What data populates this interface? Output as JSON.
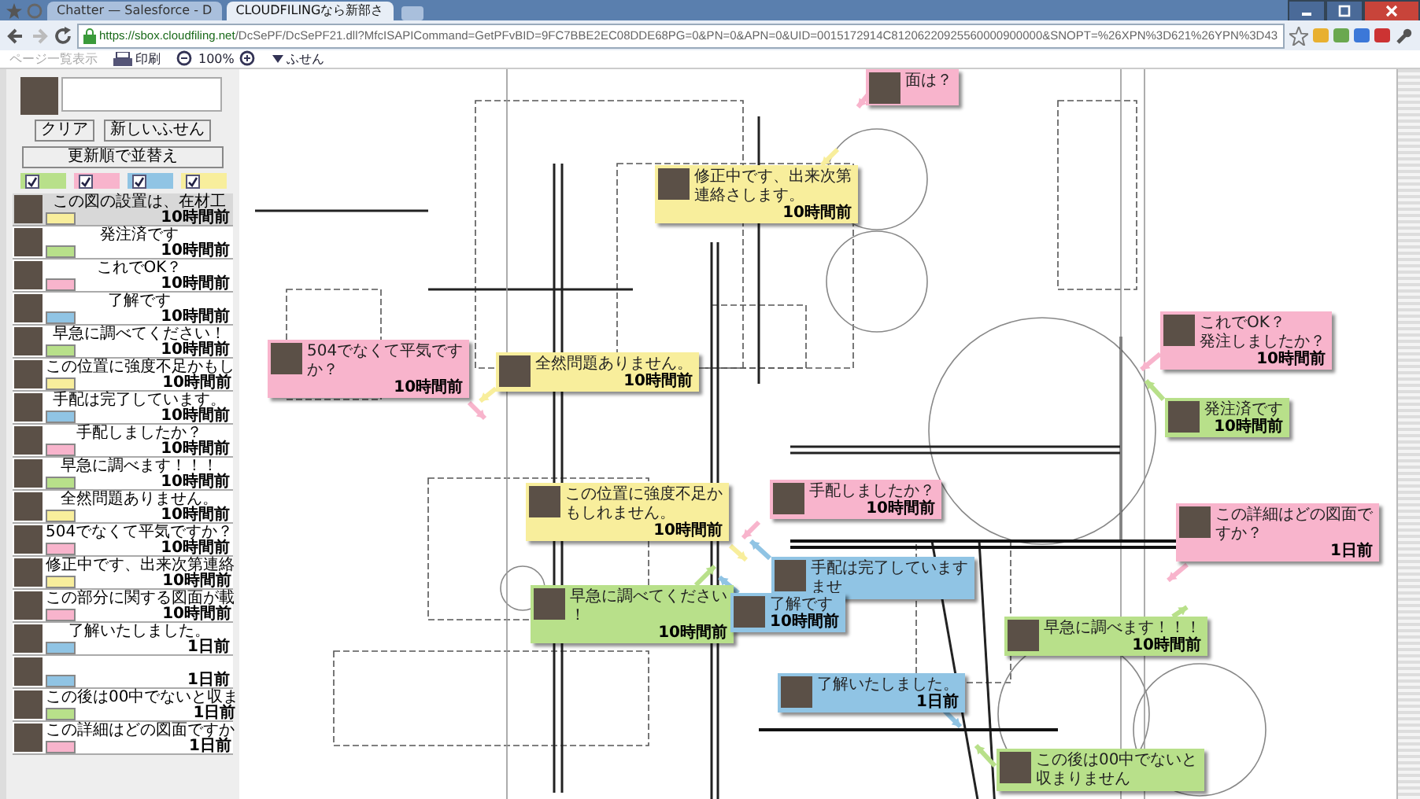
{
  "browser": {
    "tabs": [
      {
        "title": "Chatter — Salesforce - D",
        "selected": false
      },
      {
        "title": "CLOUDFILINGなら新部さ",
        "selected": true
      }
    ],
    "url_host": "https://sbox.cloudfiling.net",
    "url_path": "/DcSePF/DcSePF21.dll?MfcISAPICommand=GetPFvBID=9FC7BBE2EC08DDE68PG=0&PN=0&APN=0&UID=0015172914C81206220925560000900000&SNOPT=%26XPN%3D621%26YPN%3D43"
  },
  "toolbar": {
    "items": [
      {
        "label": "ページ一覧表示",
        "disabled": true
      },
      {
        "label": "印刷",
        "disabled": false
      }
    ],
    "zoom": "100%",
    "sticky_menu": "ふせん"
  },
  "sidebar": {
    "buttons": [
      "クリア",
      "新しいふせん"
    ],
    "sort_button": "更新順で並替え",
    "filters": [
      {
        "color": "#b8e08a",
        "checked": true
      },
      {
        "color": "#f8b4cc",
        "checked": true
      },
      {
        "color": "#90c4e4",
        "checked": true
      },
      {
        "color": "#f8ee9c",
        "checked": true
      }
    ],
    "items": [
      {
        "text": "この図の設置は、在材工",
        "time": "10時間前",
        "color": "#f8ee9c",
        "selected": true
      },
      {
        "text": "発注済です",
        "time": "10時間前",
        "color": "#b8e08a",
        "selected": false
      },
      {
        "text": "これでOK？",
        "time": "10時間前",
        "color": "#f8b4cc",
        "selected": false
      },
      {
        "text": "了解です",
        "time": "10時間前",
        "color": "#90c4e4",
        "selected": false
      },
      {
        "text": "早急に調べてください！",
        "time": "10時間前",
        "color": "#b8e08a",
        "selected": false
      },
      {
        "text": "この位置に強度不足かもし",
        "time": "10時間前",
        "color": "#f8ee9c",
        "selected": false
      },
      {
        "text": "手配は完了しています。",
        "time": "10時間前",
        "color": "#90c4e4",
        "selected": false
      },
      {
        "text": "手配しましたか？",
        "time": "10時間前",
        "color": "#f8b4cc",
        "selected": false
      },
      {
        "text": "早急に調べます！！！",
        "time": "10時間前",
        "color": "#b8e08a",
        "selected": false
      },
      {
        "text": "全然問題ありません。",
        "time": "10時間前",
        "color": "#f8ee9c",
        "selected": false
      },
      {
        "text": "504でなくて平気ですか？",
        "time": "10時間前",
        "color": "#f8b4cc",
        "selected": false
      },
      {
        "text": "修正中です、出来次第連絡",
        "time": "10時間前",
        "color": "#f8ee9c",
        "selected": false
      },
      {
        "text": "この部分に関する図面が載",
        "time": "10時間前",
        "color": "#f8b4cc",
        "selected": false
      },
      {
        "text": "了解いたしました。",
        "time": "1日前",
        "color": "#90c4e4",
        "selected": false
      },
      {
        "time": "1日前",
        "color": "#90c4e4",
        "selected": false
      },
      {
        "text": "この後は00中でないと収ま",
        "time": "1日前",
        "color": "#b8e08a",
        "selected": false
      },
      {
        "text": "この詳細はどの図面ですか",
        "time": "1日前",
        "color": "#f8b4cc",
        "selected": false
      }
    ]
  },
  "notes": [
    {
      "lines": [
        "面は？"
      ],
      "color": "#f8b4cc"
    },
    {
      "lines": [
        "修正中です、出来次第",
        "連絡さします。"
      ],
      "time": "10時間前",
      "color": "#f8ee9c"
    },
    {
      "lines": [
        "504でなくて平気です",
        "か？"
      ],
      "time": "10時間前",
      "color": "#f8b4cc"
    },
    {
      "lines": [
        "全然問題ありません。"
      ],
      "time": "10時間前",
      "color": "#f8ee9c"
    },
    {
      "lines": [
        "これでOK？",
        "発注しましたか？"
      ],
      "time": "10時間前",
      "color": "#f8b4cc"
    },
    {
      "lines": [
        "発注済です"
      ],
      "time": "10時間前",
      "color": "#b8e08a"
    },
    {
      "lines": [
        "この詳細はどの図面で",
        "すか？"
      ],
      "time": "1日前",
      "color": "#f8b4cc"
    },
    {
      "lines": [
        "この位置に強度不足か",
        "もしれません。"
      ],
      "time": "10時間前",
      "color": "#f8ee9c"
    },
    {
      "lines": [
        "手配しましたか？"
      ],
      "time": "10時間前",
      "color": "#f8b4cc"
    },
    {
      "lines": [
        "早急に調べてください",
        "！"
      ],
      "time": "10時間前",
      "color": "#b8e08a"
    },
    {
      "lines": [
        "手配は完了しています",
        "ませ"
      ],
      "color": "#90c4e4"
    },
    {
      "lines": [
        "了解です"
      ],
      "time": "10時間前",
      "color": "#90c4e4"
    },
    {
      "lines": [
        "早急に調べます！！！"
      ],
      "time": "10時間前",
      "color": "#b8e08a"
    },
    {
      "lines": [
        "了解いたしました。"
      ],
      "time": "1日前",
      "color": "#90c4e4"
    },
    {
      "lines": [
        "この後は00中でないと",
        "収まりません"
      ],
      "color": "#b8e08a"
    }
  ]
}
